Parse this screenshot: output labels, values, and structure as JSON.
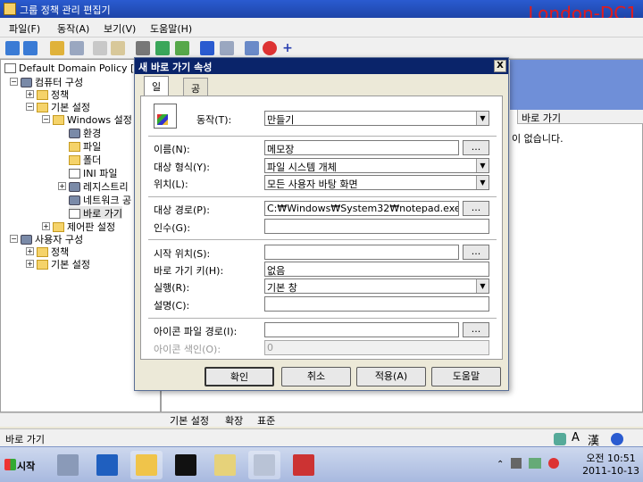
{
  "window": {
    "title": "그룹 정책 관리 편집기",
    "watermark": "London-DC1"
  },
  "menu": [
    "파일(F)",
    "동작(A)",
    "보기(V)",
    "도움말(H)"
  ],
  "tree": {
    "root": "Default Domain Policy [I",
    "computer_config": "컴퓨터 구성",
    "policies": "정책",
    "preferences": "기본 설정",
    "windows_settings": "Windows 설정",
    "environment": "환경",
    "files": "파일",
    "folders": "폴더",
    "ini_files": "INI 파일",
    "registry": "레지스트리",
    "network_shares": "네트워크 공",
    "shortcuts": "바로 가기",
    "control_panel": "제어판 설정",
    "user_config": "사용자 구성",
    "user_policies": "정책",
    "user_preferences": "기본 설정"
  },
  "right_pane": {
    "column_header": "바로 가기",
    "empty_text": "이 없습니다."
  },
  "bottom_tabs": [
    "기본 설정",
    "확장",
    "표준"
  ],
  "status": {
    "text": "바로 가기",
    "ime_a": "A",
    "ime_han": "漢"
  },
  "dialog": {
    "title": "새 바로 가기 속성",
    "close_glyph": "X",
    "tabs": [
      "일반",
      "공통"
    ],
    "action_label": "동작(T):",
    "action_value": "만들기",
    "name_label": "이름(N):",
    "name_value": "메모장",
    "target_type_label": "대상 형식(Y):",
    "target_type_value": "파일 시스템 개체",
    "location_label": "위치(L):",
    "location_value": "모든 사용자 바탕 화면",
    "target_path_label": "대상 경로(P):",
    "target_path_value": "C:₩Windows₩System32₩notepad.exe",
    "arguments_label": "인수(G):",
    "arguments_value": "",
    "start_in_label": "시작 위치(S):",
    "start_in_value": "",
    "shortcut_key_label": "바로 가기 키(H):",
    "shortcut_key_value": "없음",
    "run_label": "실행(R):",
    "run_value": "기본 창",
    "comment_label": "설명(C):",
    "comment_value": "",
    "icon_path_label": "아이콘 파일 경로(I):",
    "icon_path_value": "",
    "icon_index_label": "아이콘 색인(O):",
    "icon_index_value": "0",
    "browse": "...",
    "buttons": {
      "ok": "확인",
      "cancel": "취소",
      "apply": "적용(A)",
      "help": "도움말"
    }
  },
  "taskbar": {
    "start": "시작",
    "time": "오전 10:51",
    "date": "2011-10-13"
  }
}
